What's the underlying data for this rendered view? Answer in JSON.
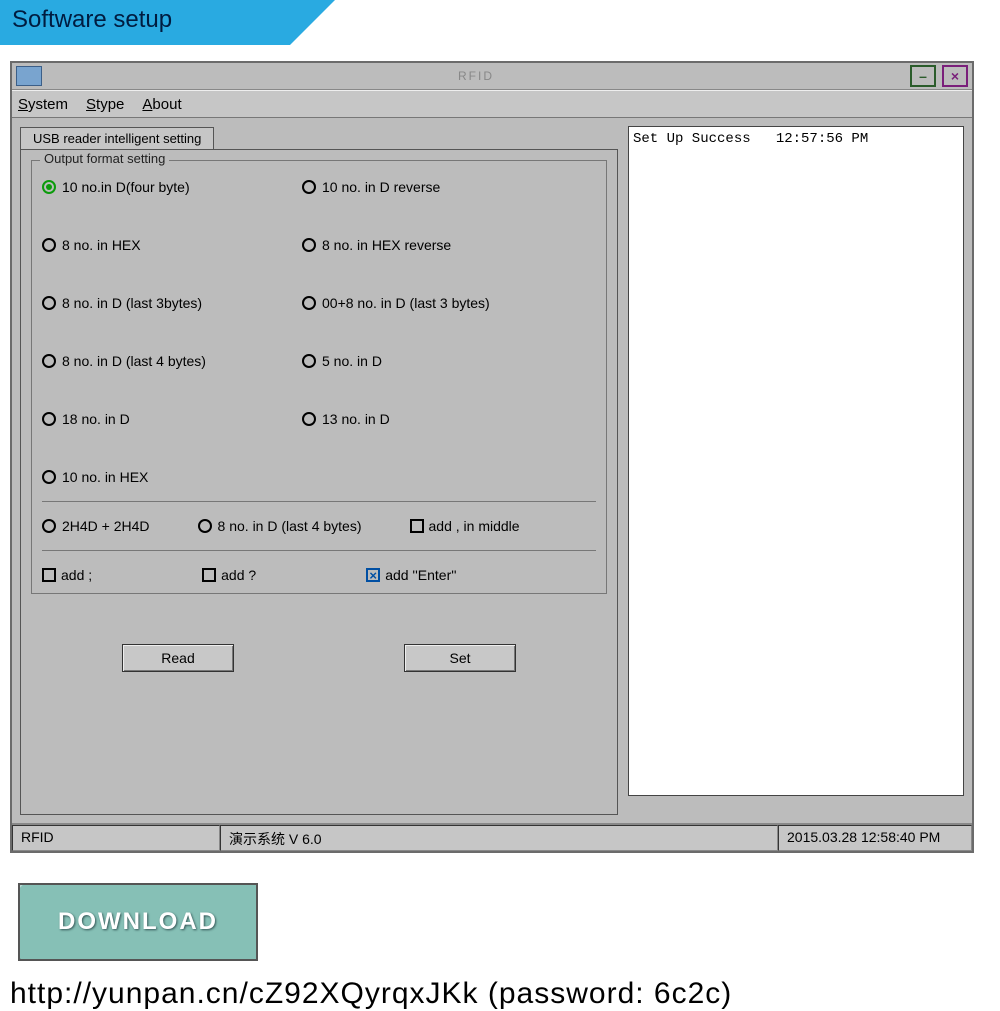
{
  "banner": "Software setup",
  "window_title": "RFID",
  "menu": {
    "system": "System",
    "stype": "Stype",
    "about": "About"
  },
  "tab": "USB reader intelligent setting",
  "fieldset_legend": "Output format setting",
  "radios": {
    "r0": "10 no.in D(four byte)",
    "r1": "10 no. in D reverse",
    "r2": "8 no. in HEX",
    "r3": "8 no. in HEX reverse",
    "r4": "8 no. in D (last 3bytes)",
    "r5": "00+8 no. in D (last 3 bytes)",
    "r6": "8 no. in D (last 4 bytes)",
    "r7": "5 no. in D",
    "r8": "18 no. in D",
    "r9": "13 no. in D",
    "r10": "10 no. in HEX",
    "r11": "2H4D + 2H4D",
    "r12": "8 no. in D (last 4 bytes)"
  },
  "checks": {
    "c_mid": "add , in middle",
    "c_semi": "add ;",
    "c_q": "add ?",
    "c_enter": "add ''Enter''"
  },
  "buttons": {
    "read": "Read",
    "set": "Set"
  },
  "log": "Set Up Success   12:57:56 PM",
  "status": {
    "left": "RFID",
    "mid": "演示系统  V 6.0",
    "right": "2015.03.28  12:58:40 PM"
  },
  "download_label": "DOWNLOAD",
  "url": "http://yunpan.cn/cZ92XQyrqxJKk  (password: 6c2c)"
}
